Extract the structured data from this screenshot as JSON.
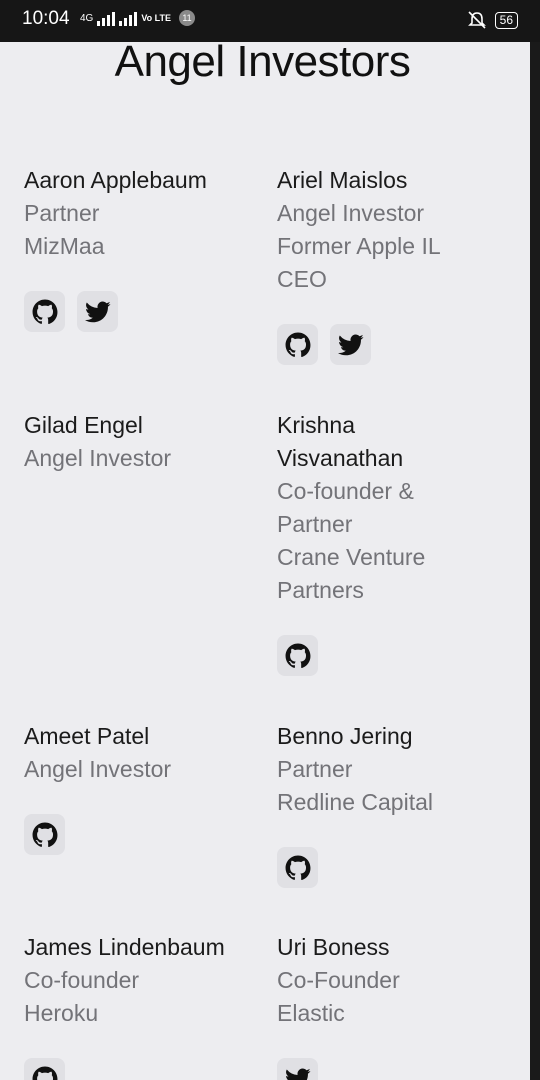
{
  "status_bar": {
    "time": "10:04",
    "network": "4G",
    "volte": "Vo LTE",
    "notification_count": "11",
    "battery": "56"
  },
  "page": {
    "title": "Angel Investors"
  },
  "investors": [
    {
      "name": "Aaron Applebaum",
      "lines": [
        "Partner",
        "MizMaa"
      ],
      "links": [
        "github-icon",
        "twitter-icon"
      ]
    },
    {
      "name": "Ariel Maislos",
      "lines": [
        "Angel Investor",
        "Former Apple IL",
        "CEO"
      ],
      "links": [
        "github-icon",
        "twitter-icon"
      ]
    },
    {
      "name": "Gilad Engel",
      "lines": [
        "Angel Investor"
      ],
      "links": []
    },
    {
      "name": "Krishna Visvanathan",
      "lines": [
        "Co-founder &",
        "Partner",
        "Crane Venture",
        "Partners"
      ],
      "links": [
        "github-icon"
      ]
    },
    {
      "name": "Ameet Patel",
      "lines": [
        "Angel Investor"
      ],
      "links": [
        "github-icon"
      ]
    },
    {
      "name": "Benno Jering",
      "lines": [
        "Partner",
        "Redline Capital"
      ],
      "links": [
        "github-icon"
      ]
    },
    {
      "name": "James Lindenbaum",
      "lines": [
        "Co-founder",
        "Heroku"
      ],
      "links": [
        "github-icon"
      ]
    },
    {
      "name": "Uri Boness",
      "lines": [
        "Co-Founder",
        "Elastic"
      ],
      "links": [
        "twitter-icon"
      ]
    }
  ]
}
